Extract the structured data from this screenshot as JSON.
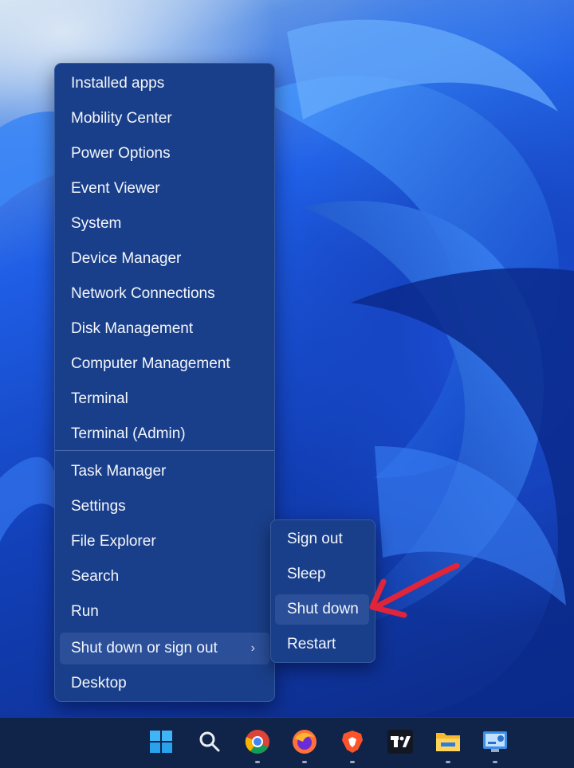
{
  "start_menu": {
    "items": [
      {
        "label": "Installed apps"
      },
      {
        "label": "Mobility Center"
      },
      {
        "label": "Power Options"
      },
      {
        "label": "Event Viewer"
      },
      {
        "label": "System"
      },
      {
        "label": "Device Manager"
      },
      {
        "label": "Network Connections"
      },
      {
        "label": "Disk Management"
      },
      {
        "label": "Computer Management"
      },
      {
        "label": "Terminal"
      },
      {
        "label": "Terminal (Admin)"
      },
      {
        "label": "Task Manager"
      },
      {
        "label": "Settings"
      },
      {
        "label": "File Explorer"
      },
      {
        "label": "Search"
      },
      {
        "label": "Run"
      },
      {
        "label": "Shut down or sign out",
        "chevron": "›"
      },
      {
        "label": "Desktop"
      }
    ]
  },
  "shutdown_submenu": {
    "items": [
      {
        "label": "Sign out"
      },
      {
        "label": "Sleep"
      },
      {
        "label": "Shut down"
      },
      {
        "label": "Restart"
      }
    ]
  },
  "taskbar": {
    "icons": [
      "windows-start-icon",
      "search-icon",
      "chrome-icon",
      "firefox-icon",
      "brave-icon",
      "tradingview-icon",
      "file-explorer-icon",
      "control-panel-icon"
    ]
  },
  "colors": {
    "menu_bg": "#1a3f8a",
    "highlight": "#2b4f98",
    "arrow": "#e0243a",
    "taskbar": "#0f2448"
  }
}
